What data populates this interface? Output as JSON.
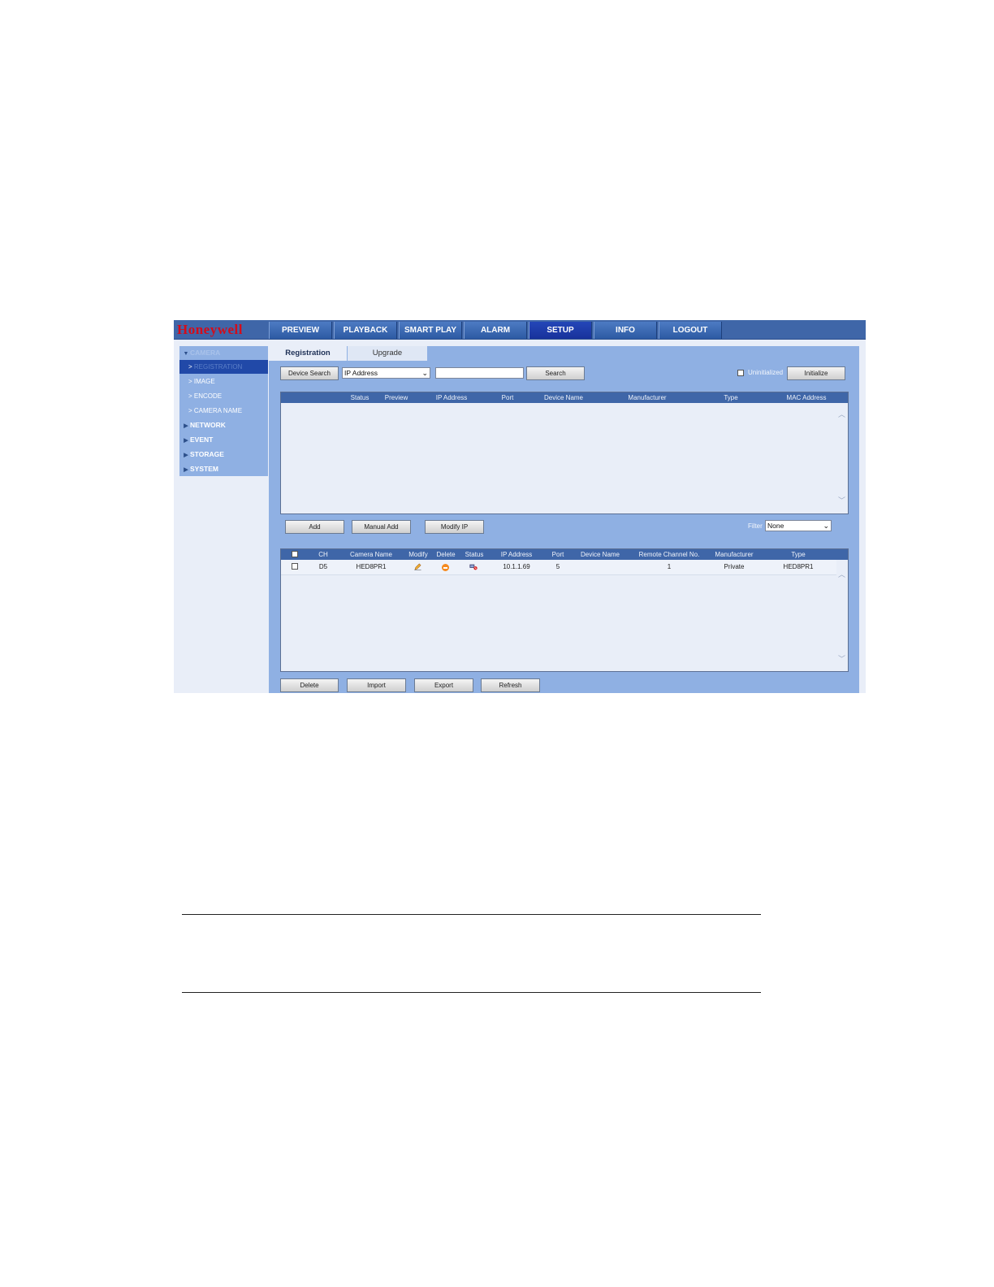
{
  "app": {
    "logo": "Honeywell",
    "nav": [
      "PREVIEW",
      "PLAYBACK",
      "SMART PLAY",
      "ALARM",
      "SETUP",
      "INFO",
      "LOGOUT"
    ],
    "active_nav": "SETUP"
  },
  "sidebar": {
    "camera_header": "CAMERA",
    "camera_items": [
      "REGISTRATION",
      "IMAGE",
      "ENCODE",
      "CAMERA NAME"
    ],
    "selected": "REGISTRATION",
    "sections": [
      "NETWORK",
      "EVENT",
      "STORAGE",
      "SYSTEM"
    ]
  },
  "tabs": {
    "registration": "Registration",
    "upgrade": "Upgrade"
  },
  "search": {
    "device_search": "Device Search",
    "filter_select": "IP Address",
    "search_btn": "Search",
    "uninitialized_label": "Uninitialized",
    "initialize_btn": "Initialize"
  },
  "found_table": {
    "columns": [
      "Status",
      "Preview",
      "IP Address",
      "Port",
      "Device Name",
      "Manufacturer",
      "Type",
      "MAC Address"
    ],
    "rows": []
  },
  "actions": {
    "add": "Add",
    "manual_add": "Manual Add",
    "modify_ip": "Modify IP",
    "filter_label": "Filter",
    "filter_value": "None"
  },
  "added_table": {
    "columns": [
      "CH",
      "Camera Name",
      "Modify",
      "Delete",
      "Status",
      "IP Address",
      "Port",
      "Device Name",
      "Remote Channel No.",
      "Manufacturer",
      "Type"
    ],
    "rows": [
      {
        "ch": "D5",
        "camera_name": "HED8PR1",
        "ip": "10.1.1.69",
        "port": "5",
        "device_name": "",
        "remote_channel": "1",
        "manufacturer": "Private",
        "type": "HED8PR1"
      }
    ]
  },
  "bottom": {
    "delete": "Delete",
    "import": "Import",
    "export": "Export",
    "refresh": "Refresh"
  },
  "colors": {
    "brand_red": "#d40c1a",
    "nav_blue": "#3f66a8",
    "panel_blue": "#8fb0e3",
    "active_tab": "#2447b8"
  }
}
